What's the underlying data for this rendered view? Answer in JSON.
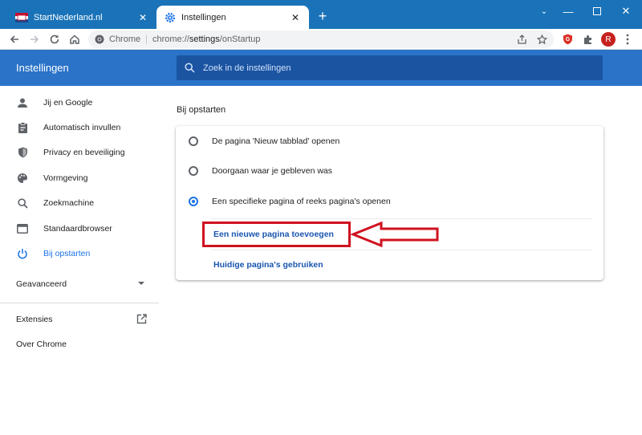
{
  "browser": {
    "tabs": [
      {
        "title": "StartNederland.nl",
        "active": false
      },
      {
        "title": "Instellingen",
        "active": true
      }
    ],
    "omnibox": {
      "site_label": "Chrome",
      "url_prefix": "chrome://",
      "url_main": "settings",
      "url_suffix": "/onStartup"
    },
    "profile_initial": "R"
  },
  "settings": {
    "title": "Instellingen",
    "search_placeholder": "Zoek in de instellingen"
  },
  "sidebar": {
    "items": [
      {
        "label": "Jij en Google",
        "icon": "person-icon"
      },
      {
        "label": "Automatisch invullen",
        "icon": "clipboard-icon"
      },
      {
        "label": "Privacy en beveiliging",
        "icon": "shield-icon"
      },
      {
        "label": "Vormgeving",
        "icon": "palette-icon"
      },
      {
        "label": "Zoekmachine",
        "icon": "search-icon"
      },
      {
        "label": "Standaardbrowser",
        "icon": "browser-window-icon"
      },
      {
        "label": "Bij opstarten",
        "icon": "power-icon",
        "active": true
      }
    ],
    "advanced": "Geavanceerd",
    "extensions": "Extensies",
    "about": "Over Chrome"
  },
  "startup": {
    "section_title": "Bij opstarten",
    "options": [
      {
        "label": "De pagina 'Nieuw tabblad' openen",
        "checked": false
      },
      {
        "label": "Doorgaan waar je gebleven was",
        "checked": false
      },
      {
        "label": "Een specifieke pagina of reeks pagina's openen",
        "checked": true
      }
    ],
    "add_page_link": "Een nieuwe pagina toevoegen",
    "use_current_link": "Huidige pagina's gebruiken"
  },
  "colors": {
    "tabstrip": "#1a73b8",
    "header": "#2a73c8",
    "accent": "#1a73e8",
    "annotation": "#d0121f"
  }
}
